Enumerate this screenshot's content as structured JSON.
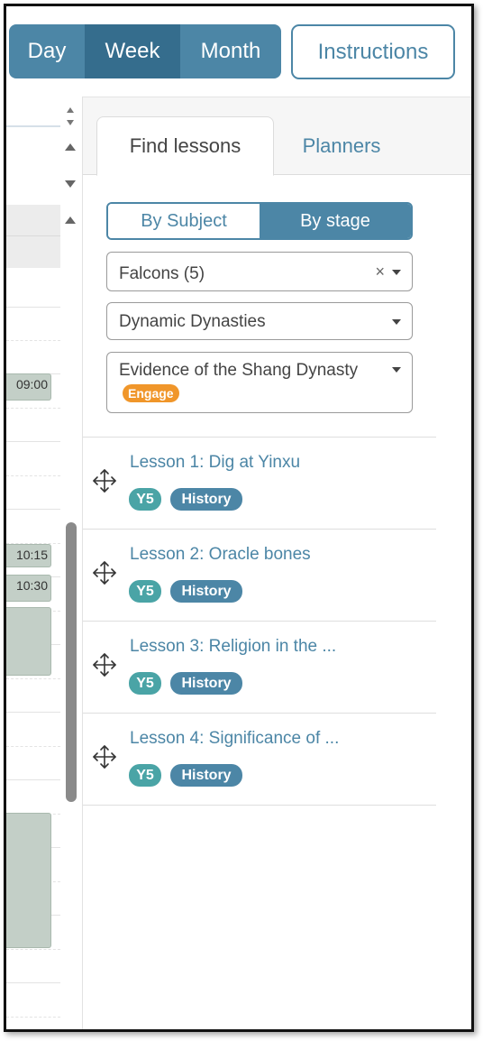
{
  "view_toggle": {
    "day": "Day",
    "week": "Week",
    "month": "Month",
    "selected": "Week"
  },
  "instructions_label": "Instructions",
  "calendar": {
    "times": [
      "09:00",
      "10:15",
      "10:30"
    ]
  },
  "panel": {
    "tabs": [
      {
        "label": "Find lessons",
        "active": true
      },
      {
        "label": "Planners",
        "active": false
      }
    ],
    "filter_mode": {
      "by_subject": "By Subject",
      "by_stage": "By stage",
      "selected": "By stage"
    },
    "selects": {
      "group": {
        "value": "Falcons (5)"
      },
      "unit": {
        "value": "Dynamic Dynasties"
      },
      "topic": {
        "value": "Evidence of the Shang Dynasty",
        "badge": "Engage"
      }
    },
    "lessons": [
      {
        "title": "Lesson 1: Dig at Yinxu",
        "year": "Y5",
        "subject": "History"
      },
      {
        "title": "Lesson 2: Oracle bones",
        "year": "Y5",
        "subject": "History"
      },
      {
        "title": "Lesson 3: Religion in the ...",
        "year": "Y5",
        "subject": "History"
      },
      {
        "title": "Lesson 4: Significance of ...",
        "year": "Y5",
        "subject": "History"
      }
    ]
  },
  "colors": {
    "primary": "#4c86a6",
    "primary_dark": "#356d8d",
    "year_tag": "#4aa4a6",
    "engage": "#f0962a",
    "event_bg": "#c3cfc7"
  },
  "icons": {
    "drag": "move-icon",
    "dropdown": "chevron-down-icon",
    "clear": "close-icon"
  }
}
